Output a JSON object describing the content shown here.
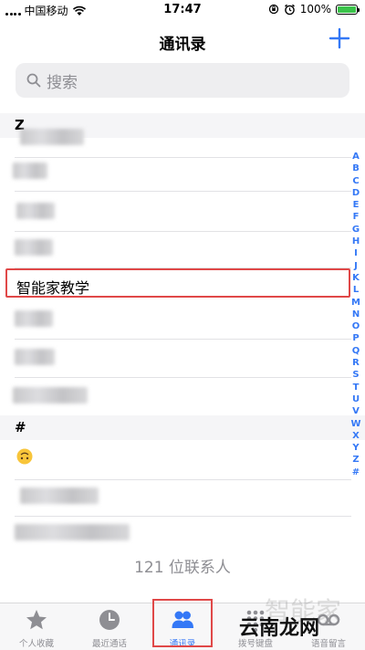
{
  "status_bar": {
    "carrier": "中国移动",
    "time": "17:47",
    "battery": "100%",
    "battery_level": 1.0
  },
  "nav": {
    "title": "通讯录",
    "add_label": "+"
  },
  "search": {
    "placeholder": "搜索"
  },
  "sections": {
    "z": "Z",
    "hash": "#"
  },
  "contacts": {
    "highlighted": "智能家教学"
  },
  "footer": {
    "count_text": "121 位联系人"
  },
  "index": [
    "A",
    "B",
    "C",
    "D",
    "E",
    "F",
    "G",
    "H",
    "I",
    "J",
    "K",
    "L",
    "M",
    "N",
    "O",
    "P",
    "Q",
    "R",
    "S",
    "T",
    "U",
    "V",
    "W",
    "X",
    "Y",
    "Z",
    "#"
  ],
  "tabs": [
    {
      "label": "个人收藏",
      "icon": "star-icon"
    },
    {
      "label": "最近通话",
      "icon": "clock-icon"
    },
    {
      "label": "通讯录",
      "icon": "contacts-icon"
    },
    {
      "label": "拨号键盘",
      "icon": "keypad-icon"
    },
    {
      "label": "语音留言",
      "icon": "voicemail-icon"
    }
  ],
  "watermark": {
    "text": "云南龙网",
    "faint_text": "智能家"
  },
  "colors": {
    "accent": "#3478f6",
    "highlight": "#e04848",
    "battery_green": "#3ac34a"
  }
}
